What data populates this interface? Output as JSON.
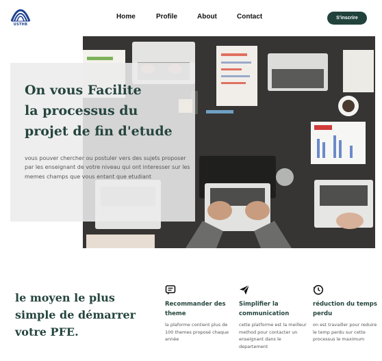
{
  "nav": {
    "logo_text": "USTHB",
    "links": [
      "Home",
      "Profile",
      "About",
      "Contact"
    ],
    "signup_label": "S'inscrire"
  },
  "hero": {
    "title_lines": [
      "On vous Facilite",
      "la processus du",
      "projet de fin d'etude"
    ],
    "description": "vous pouver chercher ou postuler vers des sujets proposer par les enseignant de votre niveau qui ont interesser sur les memes champs que vous entant que etudiant"
  },
  "bottom": {
    "title_lines": [
      "le moyen le plus",
      "simple de démarrer",
      "votre PFE."
    ],
    "features": [
      {
        "icon": "message-icon",
        "title": "Recommander des theme",
        "text": "la plaforme contient plus de 100 themes proposé chaque année"
      },
      {
        "icon": "send-icon",
        "title": "Simplifier la communication",
        "text": "cette platforme est la meilleur method pour contacter un enseignant dans le departement"
      },
      {
        "icon": "clock-icon",
        "title": "réduction du temps perdu",
        "text": "on est travailler pour reduire le temp perdu sur cette processus le maximum"
      }
    ]
  },
  "colors": {
    "accent": "#21433c",
    "heading": "#25453e"
  }
}
